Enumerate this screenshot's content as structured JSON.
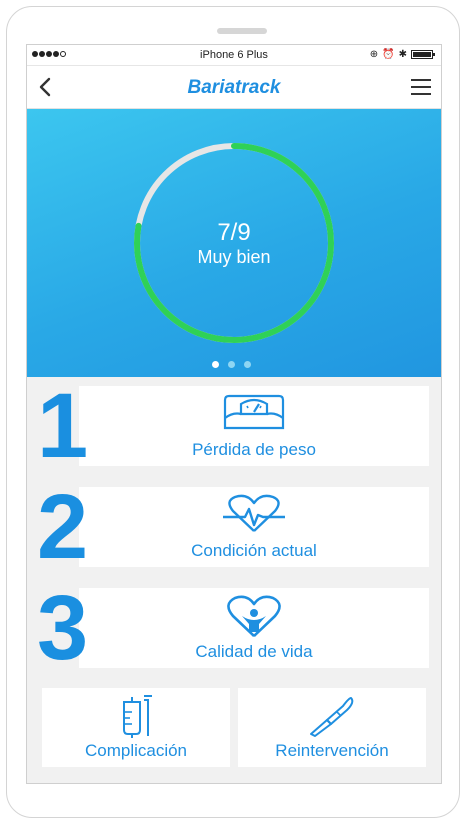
{
  "status_bar": {
    "carrier": "iPhone 6 Plus"
  },
  "header": {
    "title": "Bariatrack",
    "back_icon": "chevron-left-icon",
    "menu_icon": "hamburger-menu-icon"
  },
  "summary": {
    "score": "7/9",
    "status": "Muy bien",
    "progress_fraction": 0.778,
    "ring_color": "#2fd157",
    "ring_track_color": "#e6e6e6",
    "pages": 3,
    "active_page": 1
  },
  "steps": [
    {
      "number": "1",
      "label": "Pérdida de peso",
      "icon": "scale-icon"
    },
    {
      "number": "2",
      "label": "Condición actual",
      "icon": "heart-pulse-icon"
    },
    {
      "number": "3",
      "label": "Calidad de vida",
      "icon": "heart-person-icon"
    }
  ],
  "actions": [
    {
      "label": "Complicación",
      "icon": "iv-bag-icon"
    },
    {
      "label": "Reintervención",
      "icon": "scalpel-icon"
    }
  ],
  "colors": {
    "accent": "#1f8fe0",
    "hero_top": "#3cc6ef",
    "hero_bottom": "#2196e0"
  }
}
